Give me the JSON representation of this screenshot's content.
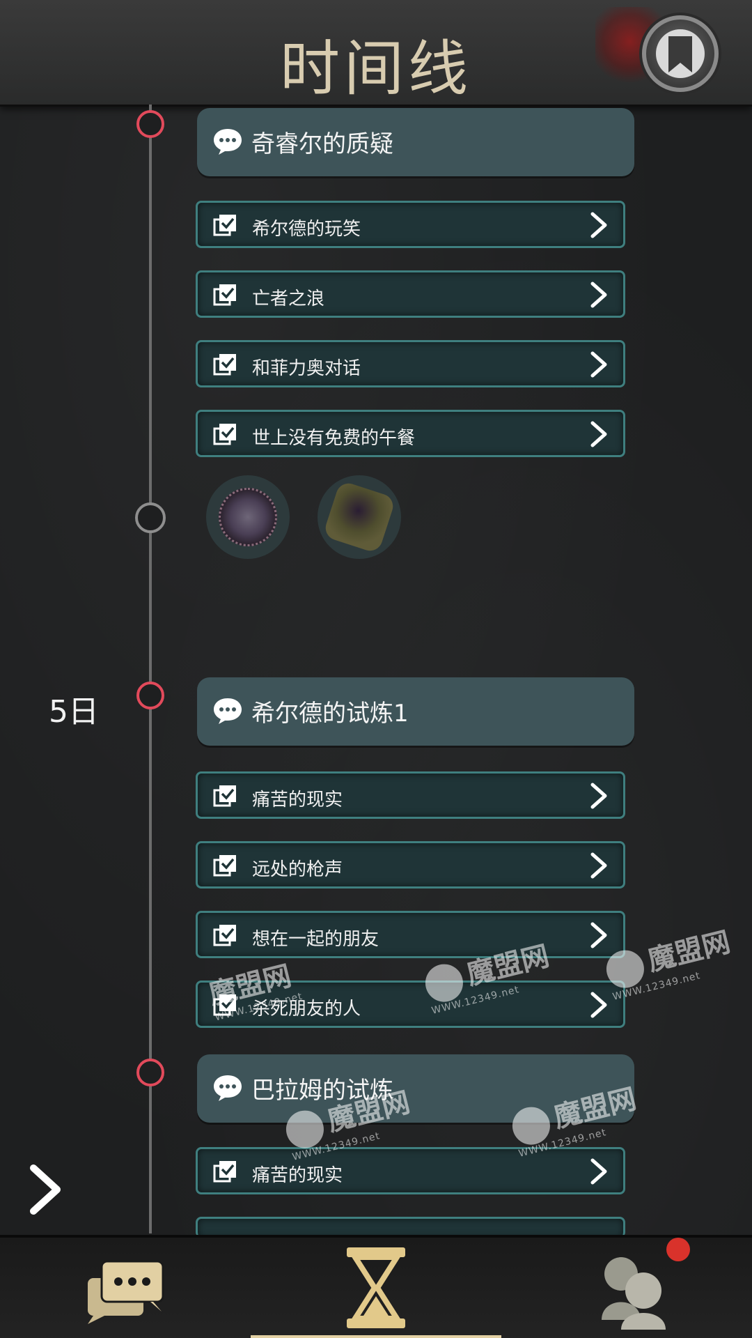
{
  "header": {
    "title": "时间线",
    "bookmark_icon": "bookmark-icon"
  },
  "timeline": {
    "day_label": "5日",
    "chapters": [
      {
        "title": "奇睿尔的质疑",
        "items": [
          "希尔德的玩笑",
          "亡者之浪",
          "和菲力奥对话",
          "世上没有免费的午餐"
        ]
      },
      {
        "title": "希尔德的试炼1",
        "items": [
          "痛苦的现实",
          "远处的枪声",
          "想在一起的朋友",
          "杀死朋友的人"
        ]
      },
      {
        "title": "巴拉姆的试炼",
        "items": [
          "痛苦的现实"
        ]
      }
    ],
    "rewards": [
      "spiked-disc-item",
      "dark-device-item"
    ]
  },
  "watermark": {
    "text": "魔盟网",
    "url": "WWW.12349.net"
  },
  "bottom_nav": {
    "chat_icon": "chat-bubbles-icon",
    "timeline_icon": "hourglass-icon",
    "people_icon": "people-icon"
  },
  "colors": {
    "accent_red": "#e24a5b",
    "chapter_bg": "#3e5459",
    "item_border": "#3f7f7f",
    "gold": "#e2d0a3"
  }
}
